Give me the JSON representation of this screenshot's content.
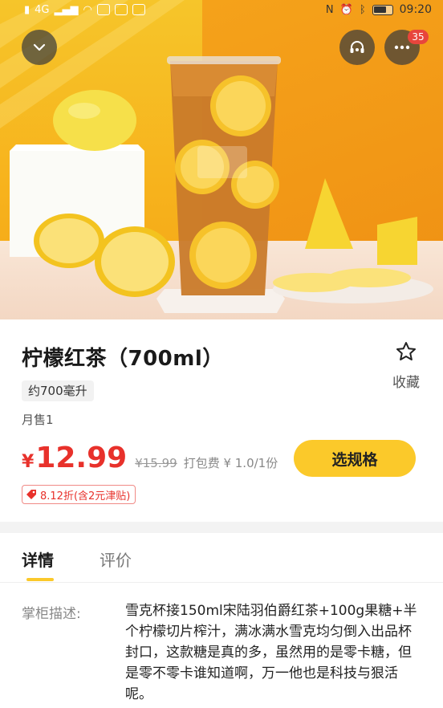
{
  "status_bar": {
    "signal_left": "4G",
    "time": "09:20"
  },
  "header": {
    "badge_count": "35"
  },
  "product": {
    "title": "柠檬红茶（700ml）",
    "favorite_label": "收藏",
    "spec_tag": "约700毫升",
    "monthly_sales": "月售1",
    "currency_symbol": "¥",
    "price": "12.99",
    "original_price": "¥15.99",
    "packing_fee": "打包费 ¥ 1.0/1份",
    "select_spec_label": "选规格",
    "discount_tag": "8.12折(含2元津贴)"
  },
  "tabs": [
    {
      "label": "详情",
      "active": true
    },
    {
      "label": "评价",
      "active": false
    }
  ],
  "description": {
    "label": "掌柜描述:",
    "text": "雪克杯接150ml宋陆羽伯爵红茶+100g果糖+半个柠檬切片榨汁，满冰满水雪克均匀倒入出品杯封口，这款糖是真的多，虽然用的是零卡糖，但是零不零卡谁知道啊，万一他也是科技与狠活呢。"
  },
  "colors": {
    "accent_yellow": "#fbc92a",
    "price_red": "#e8312b"
  }
}
